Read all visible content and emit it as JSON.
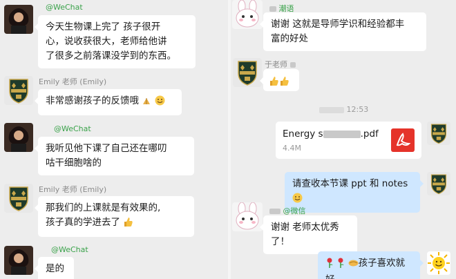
{
  "left_chat": {
    "messages": [
      {
        "sender": "@WeChat",
        "lines": [
          "今天生物课上完了 孩子很开",
          "心，说收获很大，老师给他讲",
          "了很多之前落课没学到的东西。"
        ]
      },
      {
        "sender": "Emily 老师 (Emily)",
        "text": "非常感谢孩子的反馈哦"
      },
      {
        "sender": "@WeChat",
        "lines": [
          "我听见他下课了自己还在哪叨",
          "咕干细胞啥的"
        ]
      },
      {
        "sender": "Emily 老师 (Emily)",
        "lines": [
          "那我们的上课就是有效果的,",
          "孩子真的学进去了"
        ]
      },
      {
        "sender": "@WeChat",
        "text": "是的"
      }
    ]
  },
  "right_chat": {
    "top_sender": "潮语",
    "top_lines": [
      "谢谢 这就是导师学识和经验都丰",
      "富的好处"
    ],
    "teacher_sender": "于老师",
    "timestamp": "12:53",
    "file": {
      "name_start": "Energy s",
      "name_end": ".pdf",
      "size": "4.4M"
    },
    "notes_message": "请查收本节课 ppt 和 notes",
    "mid_sender": "@微信",
    "reply": "谢谢 老师太优秀了！",
    "last_message": "孩子喜欢就好"
  },
  "icons": {
    "left_avatar": "portrait-avatar",
    "crest": "school-crest-avatar",
    "bunny": "bunny-avatar",
    "file": "pdf-file-icon",
    "smiley": "sun-smiley-avatar"
  },
  "colors": {
    "wechat_green": "#3aa24a",
    "blue_bubble": "#cfe7ff",
    "pdf_red": "#e5332a",
    "crest_green": "#1f3b2b",
    "crest_gold": "#c9a84b"
  }
}
